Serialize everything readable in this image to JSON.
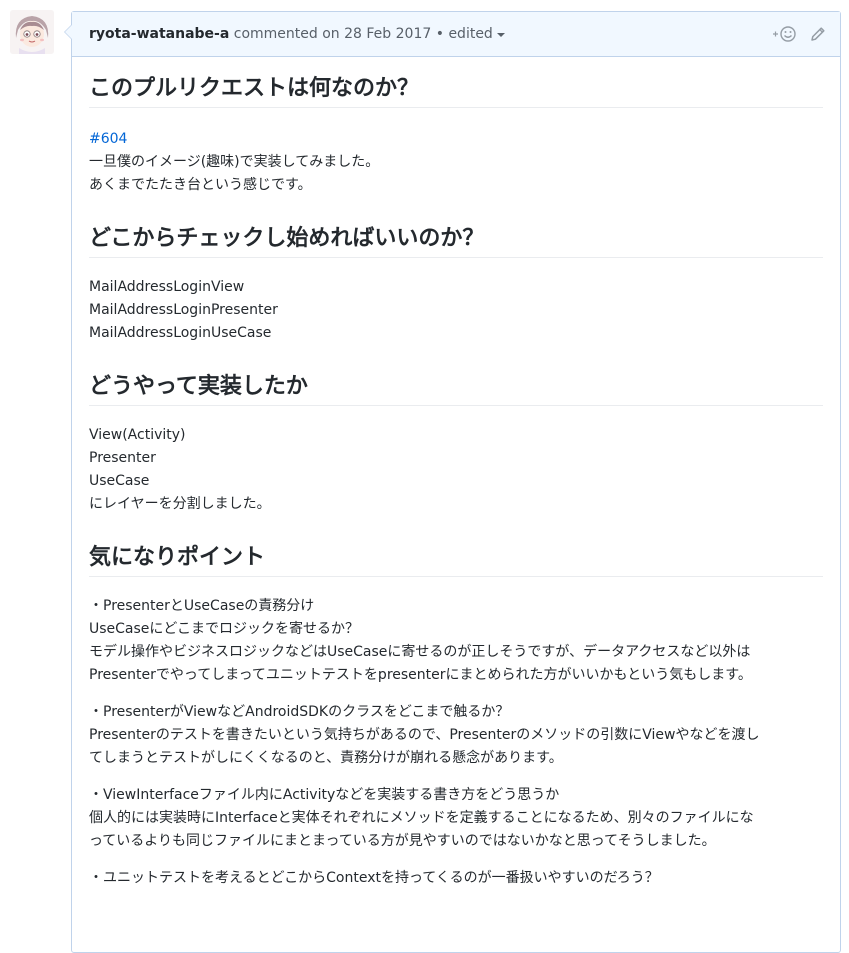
{
  "comment": {
    "author": "ryota-watanabe-a",
    "action": "commented on",
    "date": "28 Feb 2017",
    "separator": "•",
    "edited": "edited"
  },
  "sections": [
    {
      "heading": "このプルリクエストは何なのか？",
      "link": "#604",
      "lines": [
        "一旦僕のイメージ(趣味)で実装してみました。",
        "あくまでたたき台という感じです。"
      ]
    },
    {
      "heading": "どこからチェックし始めればいいのか？",
      "lines": [
        "MailAddressLoginView",
        "MailAddressLoginPresenter",
        "MailAddressLoginUseCase"
      ]
    },
    {
      "heading": "どうやって実装したか",
      "lines": [
        "View(Activity)",
        "Presenter",
        "UseCase",
        "にレイヤーを分割しました。"
      ]
    },
    {
      "heading": "気になりポイント",
      "paragraphs": [
        [
          "・PresenterとUseCaseの責務分け",
          "UseCaseにどこまでロジックを寄せるか？",
          "モデル操作やビジネスロジックなどはUseCaseに寄せるのが正しそうですが、データアクセスなど以外は",
          "Presenterでやってしまってユニットテストをpresenterにまとめられた方がいいかもという気もします。"
        ],
        [
          "・PresenterがViewなどAndroidSDKのクラスをどこまで触るか？",
          "Presenterのテストを書きたいという気持ちがあるので、Presenterのメソッドの引数にViewやなどを渡し",
          "てしまうとテストがしにくくなるのと、責務分けが崩れる懸念があります。"
        ],
        [
          "・ViewInterfaceファイル内にActivityなどを実装する書き方をどう思うか",
          "個人的には実装時にInterfaceと実体それぞれにメソッドを定義することになるため、別々のファイルにな",
          "っているよりも同じファイルにまとまっている方が見やすいのではないかなと思ってそうしました。"
        ],
        [
          "・ユニットテストを考えるとどこからContextを持ってくるのが一番扱いやすいのだろう？"
        ]
      ]
    }
  ]
}
